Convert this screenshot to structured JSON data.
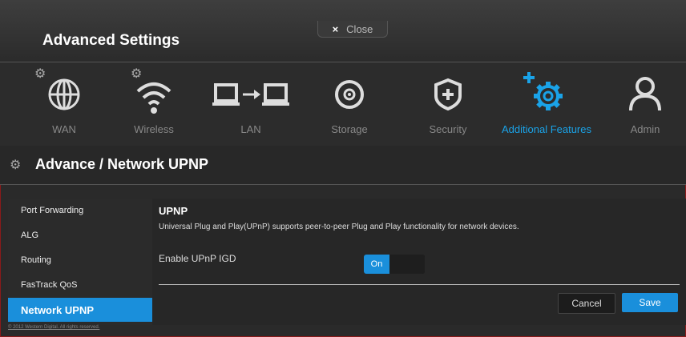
{
  "header": {
    "title": "Advanced Settings",
    "close_label": "Close",
    "close_glyph": "×"
  },
  "nav": {
    "items": [
      {
        "label": "WAN",
        "icon": "globe-icon"
      },
      {
        "label": "Wireless",
        "icon": "wifi-icon"
      },
      {
        "label": "LAN",
        "icon": "lan-icon"
      },
      {
        "label": "Storage",
        "icon": "storage-icon"
      },
      {
        "label": "Security",
        "icon": "shield-icon"
      },
      {
        "label": "Additional Features",
        "icon": "gear-icon",
        "active": true
      },
      {
        "label": "Admin",
        "icon": "user-icon"
      }
    ]
  },
  "page": {
    "title": "Advance / Network UPNP"
  },
  "sidebar": {
    "items": [
      {
        "label": "Port Forwarding"
      },
      {
        "label": "ALG"
      },
      {
        "label": "Routing"
      },
      {
        "label": "FasTrack QoS"
      },
      {
        "label": "Network UPNP",
        "active": true
      }
    ]
  },
  "main": {
    "section_title": "UPNP",
    "description": "Universal Plug and Play(UPnP) supports peer-to-peer Plug and Play functionality for network devices.",
    "field_label": "Enable UPnP IGD",
    "toggle_on_label": "On",
    "toggle_state": true,
    "cancel_label": "Cancel",
    "save_label": "Save"
  },
  "footer": {
    "copyright": "© 2012 Western Digital. All rights reserved."
  },
  "colors": {
    "accent": "#1a8fdb",
    "active_text": "#1aa3e8"
  }
}
